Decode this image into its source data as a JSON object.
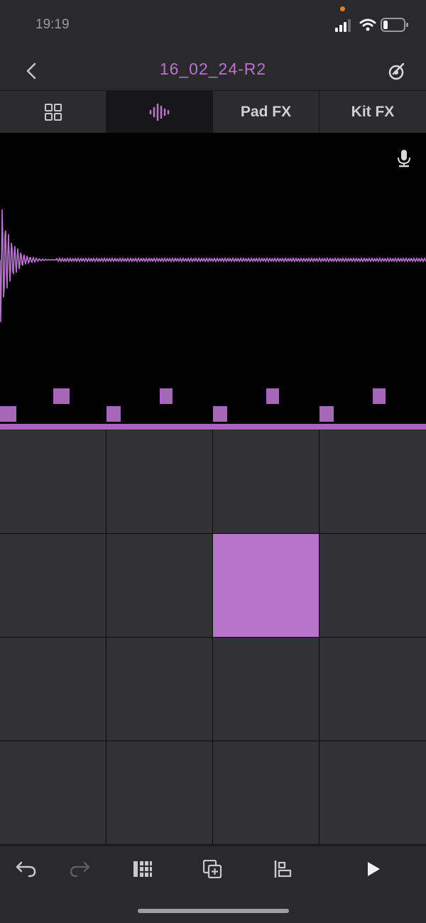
{
  "status": {
    "time": "19:19"
  },
  "header": {
    "title": "16_02_24-R2"
  },
  "tabs": [
    {
      "id": "grid",
      "label": "",
      "icon": "grid-icon"
    },
    {
      "id": "waveform",
      "label": "",
      "icon": "waveform-icon",
      "active": true
    },
    {
      "id": "pad_fx",
      "label": "Pad FX"
    },
    {
      "id": "kit_fx",
      "label": "Kit FX"
    }
  ],
  "pads": {
    "rows": 4,
    "cols": 4,
    "active_index": 6
  },
  "colors": {
    "accent": "#b774cc",
    "pad": "#323134",
    "pad_active": "#b774c9",
    "background": "#2a292c"
  },
  "toolbar": [
    "undo-icon",
    "redo-icon",
    "step-sequencer-icon",
    "duplicate-icon",
    "align-icon",
    "play-icon"
  ]
}
